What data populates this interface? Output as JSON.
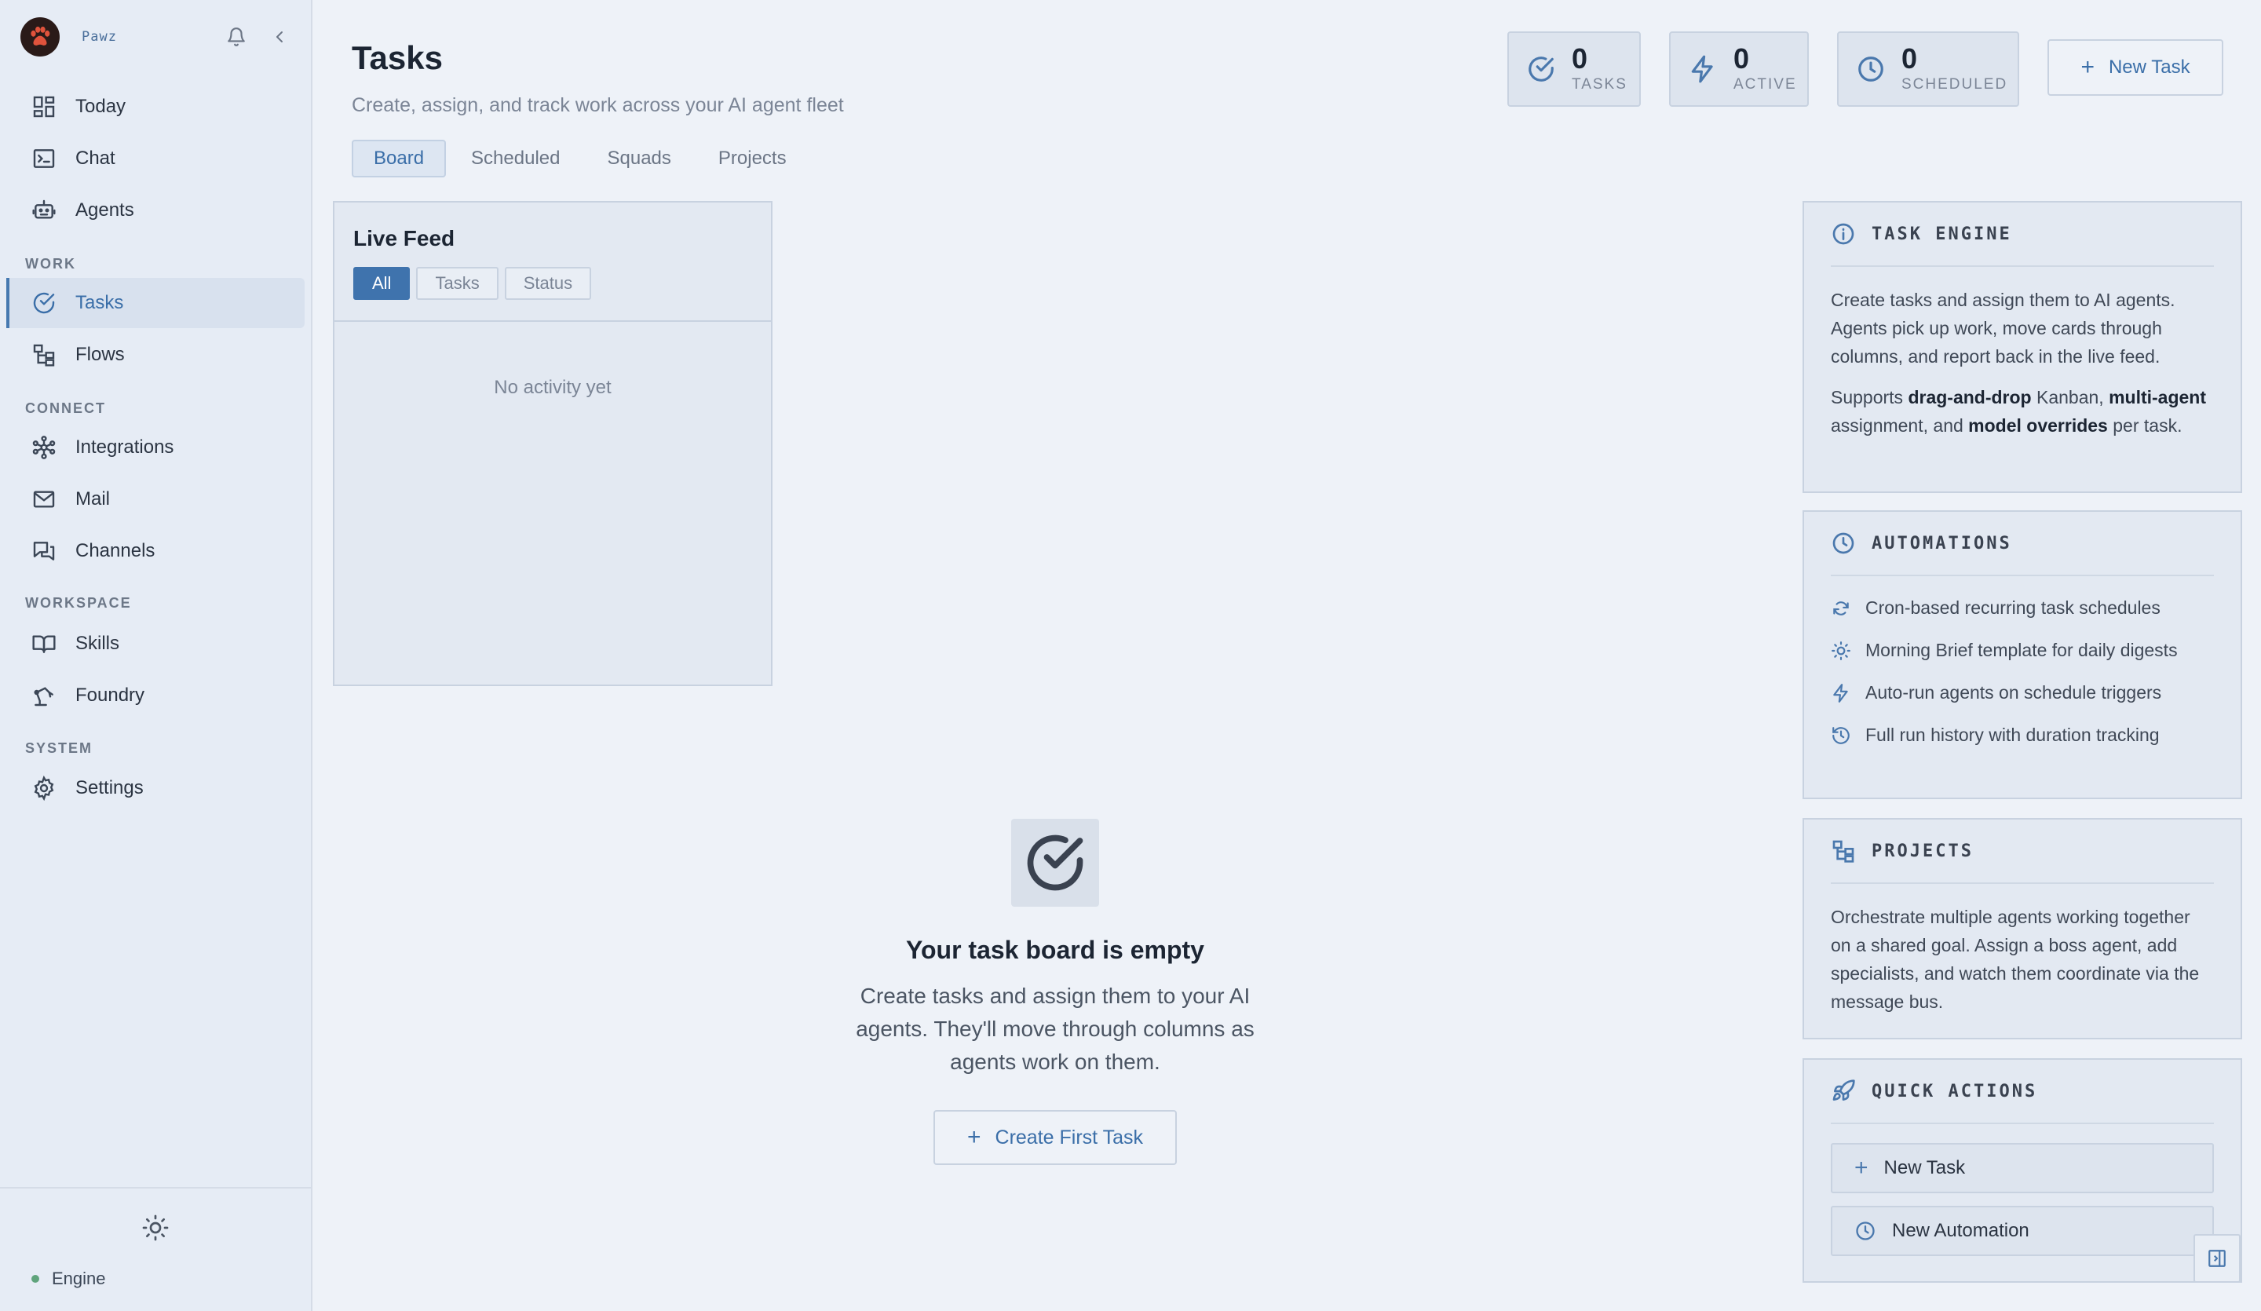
{
  "sidebar": {
    "brand": "Pawz",
    "nav": {
      "today": "Today",
      "chat": "Chat",
      "agents": "Agents",
      "tasks": "Tasks",
      "flows": "Flows",
      "integrations": "Integrations",
      "mail": "Mail",
      "channels": "Channels",
      "skills": "Skills",
      "foundry": "Foundry",
      "settings": "Settings"
    },
    "sections": {
      "work": "WORK",
      "connect": "CONNECT",
      "workspace": "WORKSPACE",
      "system": "SYSTEM"
    },
    "engine_label": "Engine",
    "engine_status_color": "#5fa47c"
  },
  "header": {
    "title": "Tasks",
    "subtitle": "Create, assign, and track work across your AI agent fleet",
    "tabs": [
      "Board",
      "Scheduled",
      "Squads",
      "Projects"
    ],
    "stats": [
      {
        "value": "0",
        "label": "TASKS"
      },
      {
        "value": "0",
        "label": "ACTIVE"
      },
      {
        "value": "0",
        "label": "SCHEDULED"
      }
    ],
    "new_task_label": "New Task"
  },
  "live_feed": {
    "title": "Live Feed",
    "filters": [
      "All",
      "Tasks",
      "Status"
    ],
    "empty_text": "No activity yet"
  },
  "empty_state": {
    "title": "Your task board is empty",
    "description": "Create tasks and assign them to your AI agents. They'll move through columns as agents work on them.",
    "button_label": "Create First Task"
  },
  "panels": {
    "task_engine": {
      "title": "TASK ENGINE",
      "para1": "Create tasks and assign them to AI agents. Agents pick up work, move cards through columns, and report back in the live feed.",
      "para2_prefix": "Supports ",
      "para2_b1": "drag-and-drop",
      "para2_mid1": " Kanban, ",
      "para2_b2": "multi-agent",
      "para2_mid2": " assignment, and ",
      "para2_b3": "model overrides",
      "para2_suffix": " per task."
    },
    "automations": {
      "title": "AUTOMATIONS",
      "items": [
        "Cron-based recurring task schedules",
        "Morning Brief template for daily digests",
        "Auto-run agents on schedule triggers",
        "Full run history with duration tracking"
      ]
    },
    "projects": {
      "title": "PROJECTS",
      "text": "Orchestrate multiple agents working together on a shared goal. Assign a boss agent, add specialists, and watch them coordinate via the message bus."
    },
    "quick_actions": {
      "title": "QUICK ACTIONS",
      "new_task": "New Task",
      "new_automation": "New Automation"
    }
  },
  "colors": {
    "accent": "#3f73ad",
    "background": "#eef2f8",
    "sidebar": "#e6ecf5"
  }
}
